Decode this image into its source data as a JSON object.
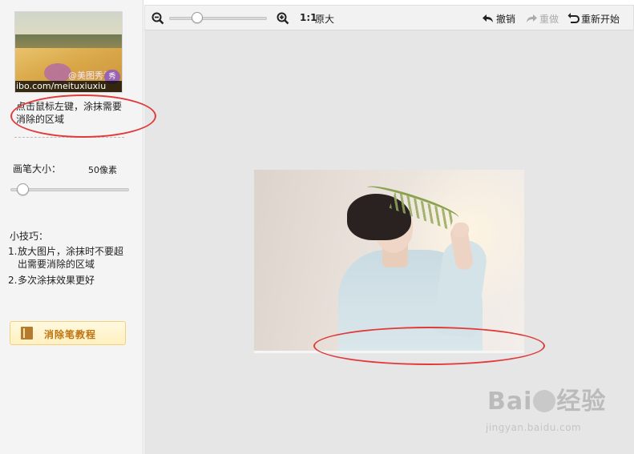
{
  "preview": {
    "watermark_text": "@美图秀秀",
    "watermark_badge": "秀",
    "url_text": "ibo.com/meituxiuxiu"
  },
  "sidebar": {
    "hint": "点击鼠标左键，涂抹需要消除的区域",
    "brush_label": "画笔大小：",
    "brush_value": "50像素",
    "tips_title": "小技巧：",
    "tips": [
      {
        "num": "1.",
        "line1": "放大图片，涂抹时不要超",
        "line2": "出需要消除的区域"
      },
      {
        "num": "2.",
        "line1": "多次涂抹效果更好"
      }
    ],
    "tutorial_button": "消除笔教程"
  },
  "toolbar": {
    "zoom_out_icon": "zoom-out-icon",
    "zoom_in_icon": "zoom-in-icon",
    "ratio_label": "1:1",
    "original_size": "原大",
    "undo": "撤销",
    "redo": "重做",
    "restart": "重新开始"
  },
  "watermark": {
    "brand_left": "Bai",
    "brand_right": "经验",
    "url": "jingyan.baidu.com"
  },
  "colors": {
    "annotation_red": "#e23a3a",
    "tab_purple": "#c9a9e6",
    "button_text": "#c07310"
  }
}
